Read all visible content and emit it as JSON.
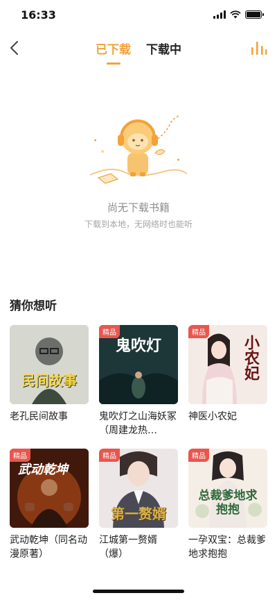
{
  "status": {
    "time": "16:33"
  },
  "header": {
    "tabs": [
      {
        "label": "已下载",
        "active": true
      },
      {
        "label": "下载中",
        "active": false
      }
    ]
  },
  "empty_state": {
    "title": "尚无下载书籍",
    "subtitle": "下载到本地，无网络时也能听"
  },
  "recommend": {
    "title": "猜你想听",
    "badge_label": "精品",
    "books": [
      {
        "title": "老孔民间故事",
        "badge": false,
        "cover_text": "民间故事"
      },
      {
        "title": "鬼吹灯之山海妖冢（周建龙热…",
        "badge": true,
        "cover_text": "鬼吹灯"
      },
      {
        "title": "神医小农妃",
        "badge": true,
        "cover_text": "小农妃"
      },
      {
        "title": "武动乾坤（同名动漫原著）",
        "badge": true,
        "cover_text": "武动乾坤"
      },
      {
        "title": "江城第一赘婿（爆）",
        "badge": true,
        "cover_text": "第一赘婿"
      },
      {
        "title": "一孕双宝：总裁爹地求抱抱",
        "badge": true,
        "cover_text": "总裁爹地求抱抱"
      }
    ]
  },
  "colors": {
    "accent": "#F2A23A",
    "badge": "#E9564E"
  }
}
